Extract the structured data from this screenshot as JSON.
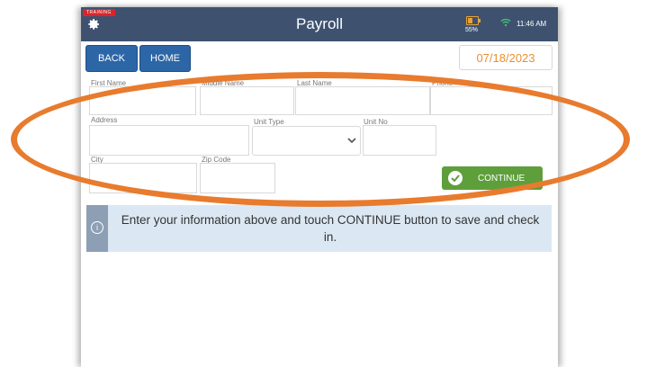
{
  "header": {
    "training_badge": "TRAINING",
    "title": "Payroll",
    "battery_percent": "55%",
    "battery_level": 0.55,
    "time": "11:46 AM",
    "gear_icon": "gear-icon",
    "wifi_icon": "wifi-icon"
  },
  "nav": {
    "back_label": "BACK",
    "home_label": "HOME",
    "date": "07/18/2023"
  },
  "form": {
    "first_name_label": "First Name",
    "middle_name_label": "Middle Name",
    "last_name_label": "Last Name",
    "fourth_label": "Phone",
    "address_label": "Address",
    "unit_type_label": "Unit Type",
    "unit_no_label": "Unit No",
    "city_label": "City",
    "zip_label": "Zip Code",
    "continue_label": "CONTINUE"
  },
  "info": {
    "message": "Enter your information above and touch CONTINUE button to save and check in."
  },
  "colors": {
    "header_bg": "#3e5270",
    "button_blue": "#2d66a6",
    "continue_green": "#5e9f3c",
    "date_orange": "#e8912e",
    "annotation_orange": "#e87b2e",
    "info_bg": "#dbe8f3"
  }
}
